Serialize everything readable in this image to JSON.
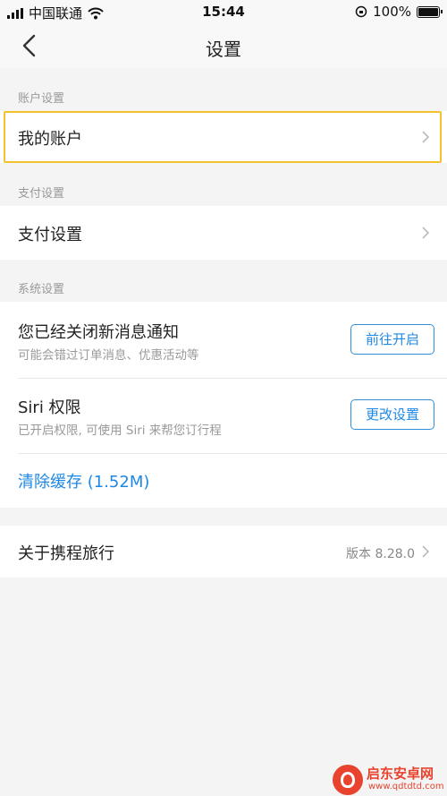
{
  "status": {
    "carrier": "中国联通",
    "time": "15:44",
    "battery": "100%"
  },
  "nav": {
    "title": "设置"
  },
  "sections": {
    "account": {
      "label": "账户设置",
      "item": "我的账户"
    },
    "payment": {
      "label": "支付设置",
      "item": "支付设置"
    },
    "system": {
      "label": "系统设置",
      "notify": {
        "title": "您已经关闭新消息通知",
        "subtitle": "可能会错过订单消息、优惠活动等",
        "button": "前往开启"
      },
      "siri": {
        "title": "Siri 权限",
        "subtitle": "已开启权限, 可使用 Siri 来帮您订行程",
        "button": "更改设置"
      },
      "cache": {
        "label": "清除缓存 (1.52M)"
      }
    },
    "about": {
      "title": "关于携程旅行",
      "version": "版本 8.28.0"
    }
  },
  "watermark": {
    "name": "启东安卓网",
    "url": "www.qdtdtd.com"
  },
  "colors": {
    "accent": "#1e88e5",
    "highlight": "#f5c12e",
    "background": "#f4f4f4"
  }
}
